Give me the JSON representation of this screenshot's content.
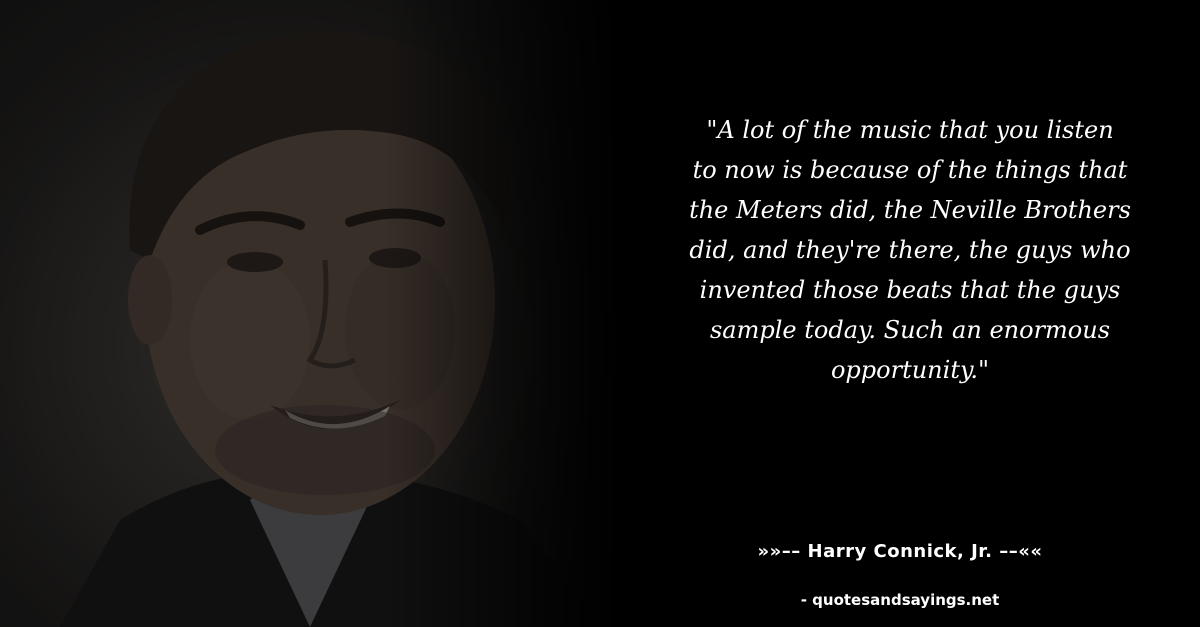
{
  "quote": {
    "lines": [
      "\"A lot of the music that you listen",
      "to now is because of the things that",
      "the Meters did, the Neville Brothers",
      "did, and they're there, the guys who",
      "invented those beats that the guys",
      "sample today. Such an enormous",
      "opportunity.\""
    ]
  },
  "author": "»»–– Harry Connick, Jr. ––««",
  "source": "- quotesandsayings.net",
  "colors": {
    "background": "#000000",
    "text": "#ffffff"
  }
}
